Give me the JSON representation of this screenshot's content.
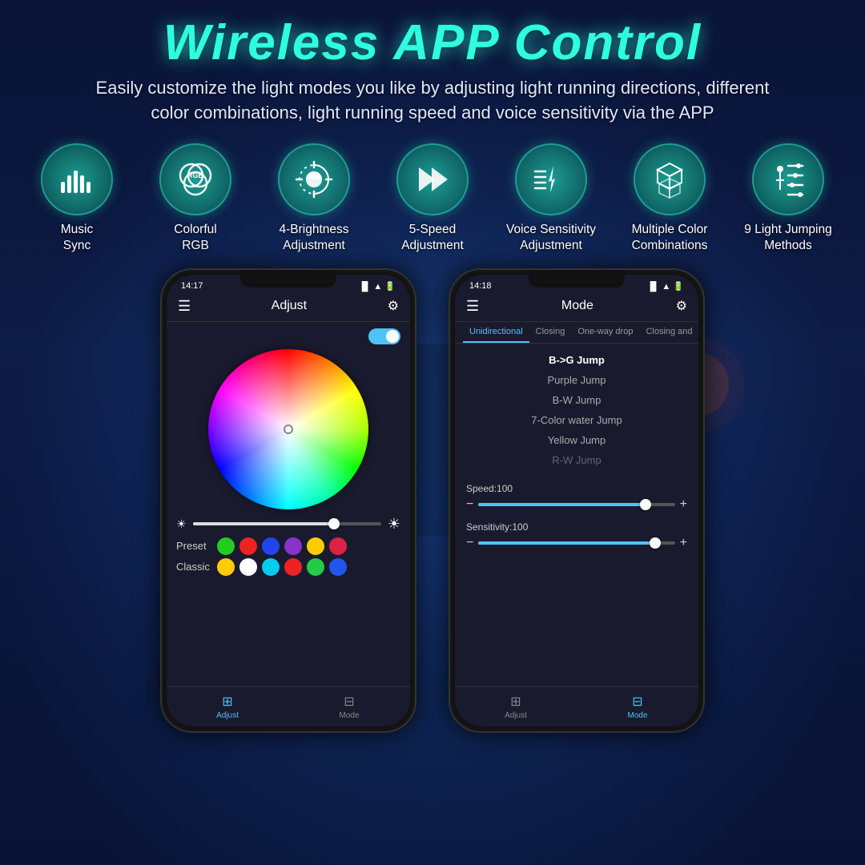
{
  "header": {
    "main_title": "Wireless APP Control",
    "subtitle_line1": "Easily customize the light modes you like by adjusting light running directions, different",
    "subtitle_line2": "color combinations, light running speed and voice sensitivity via the APP"
  },
  "features": [
    {
      "id": "music-sync",
      "label": "Music\nSync",
      "icon_type": "bars"
    },
    {
      "id": "colorful-rgb",
      "label": "Colorful\nRGB",
      "icon_type": "rgb-circles"
    },
    {
      "id": "brightness",
      "label": "4-Brightness\nAdjustment",
      "icon_type": "brightness"
    },
    {
      "id": "speed",
      "label": "5-Speed\nAdjustment",
      "icon_type": "speed"
    },
    {
      "id": "voice-sensitivity",
      "label": "Voice Sensitivity\nAdjustment",
      "icon_type": "voice"
    },
    {
      "id": "multiple-color",
      "label": "Multiple Color\nCombinations",
      "icon_type": "cubes"
    },
    {
      "id": "light-jumping",
      "label": "9 Light Jumping\nMethods",
      "icon_type": "sliders"
    }
  ],
  "phone1": {
    "time": "14:17",
    "title": "Adjust",
    "toggle_on": true,
    "brightness_pct": 75,
    "preset_colors": [
      "#22cc22",
      "#ee2222",
      "#2244ee",
      "#8833cc",
      "#ffcc00",
      "#dd2244"
    ],
    "classic_colors": [
      "#ffcc00",
      "#ffffff",
      "#00ccee",
      "#ee2222",
      "#22cc44",
      "#2255ee"
    ]
  },
  "phone2": {
    "time": "14:18",
    "title": "Mode",
    "tabs": [
      "Unidirectional",
      "Closing",
      "One-way drop",
      "Closing and"
    ],
    "active_tab": "Unidirectional",
    "modes": [
      "B->G Jump",
      "Purple Jump",
      "B-W Jump",
      "7-Color water Jump",
      "Yellow Jump",
      "R-W Jump"
    ],
    "selected_mode": "B->G Jump",
    "speed_label": "Speed:100",
    "sensitivity_label": "Sensitivity:100"
  },
  "colors": {
    "accent": "#2effe0",
    "icon_bg": "rgba(30,180,160,0.85)",
    "active_tab": "#4FC3F7"
  }
}
